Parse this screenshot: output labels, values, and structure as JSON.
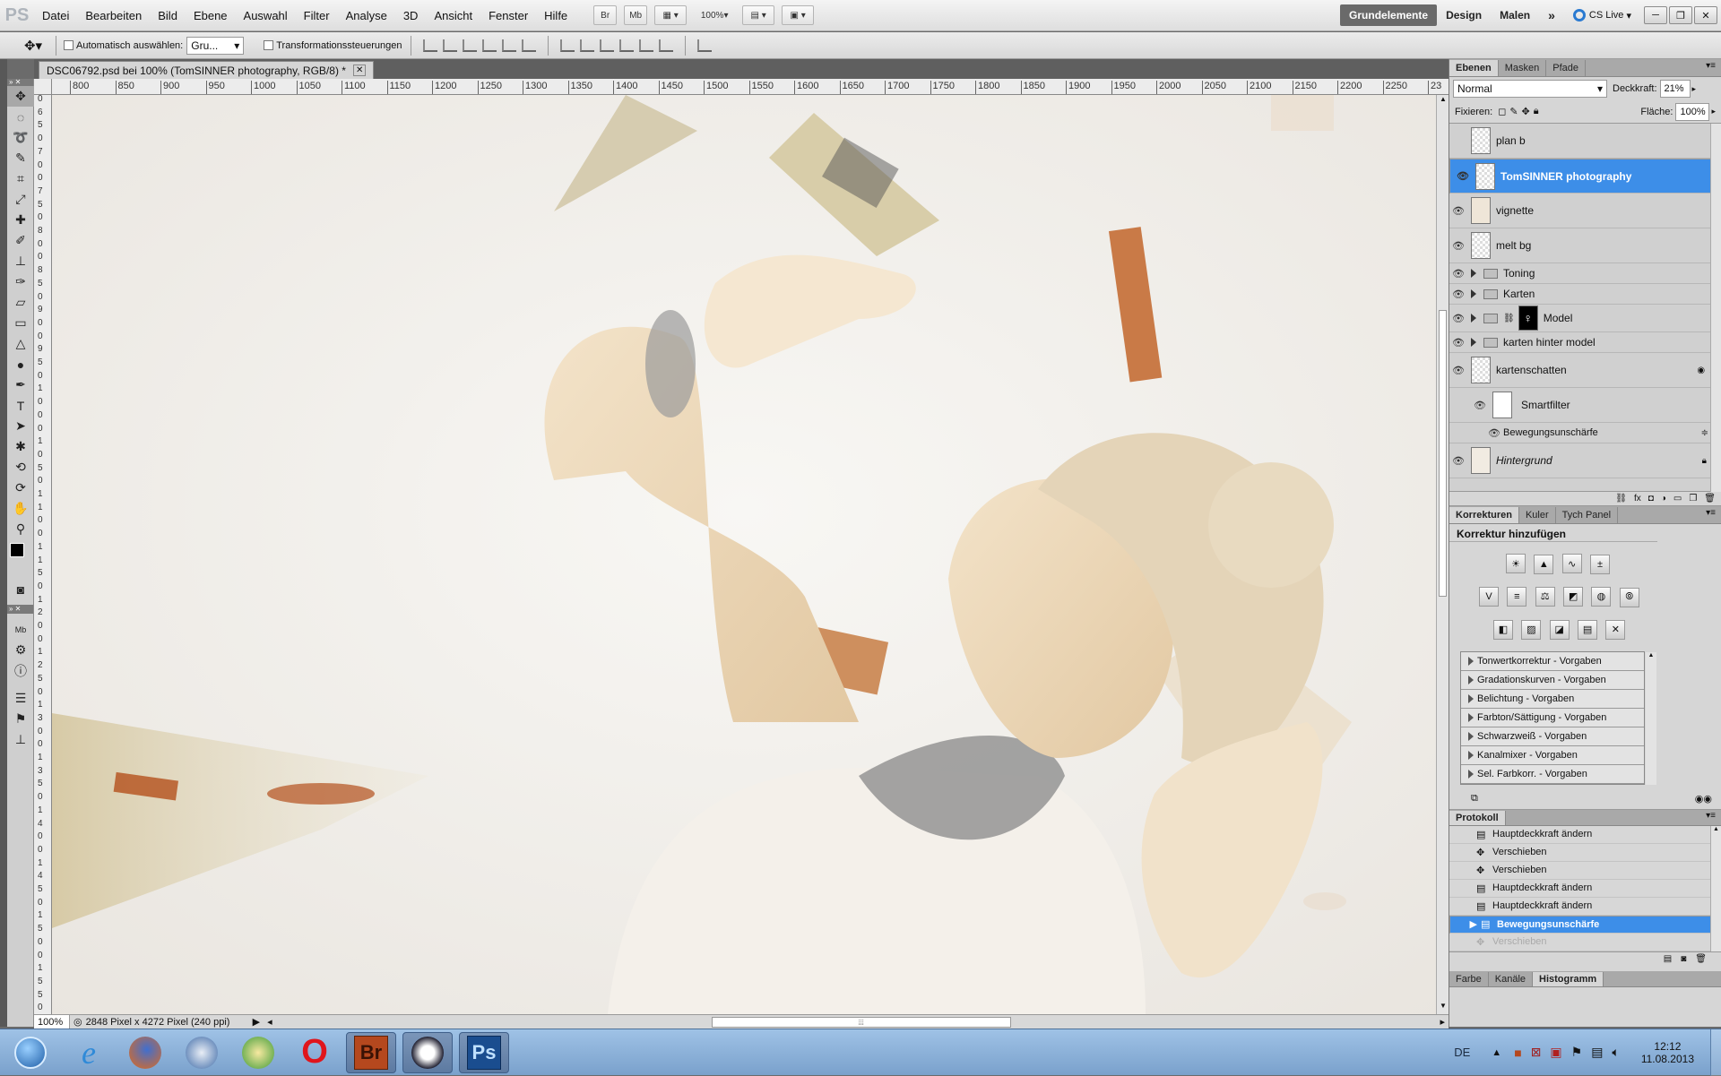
{
  "app": {
    "logo": "PS"
  },
  "menu": [
    "Datei",
    "Bearbeiten",
    "Bild",
    "Ebene",
    "Auswahl",
    "Filter",
    "Analyse",
    "3D",
    "Ansicht",
    "Fenster",
    "Hilfe"
  ],
  "menu_buttons": {
    "br": "Br",
    "mb": "Mb",
    "zoom": "100%"
  },
  "workspaces": [
    "Grundelemente",
    "Design",
    "Malen"
  ],
  "cslive": "CS Live",
  "options": {
    "auto_select_label": "Automatisch auswählen:",
    "auto_select_value": "Gru...",
    "transform_label": "Transformationssteuerungen"
  },
  "document": {
    "tab_title": "DSC06792.psd bei 100% (TomSINNER photography, RGB/8) *",
    "zoom": "100%",
    "size_info": "2848 Pixel x 4272 Pixel (240 ppi)"
  },
  "ruler_top": [
    "800",
    "850",
    "900",
    "950",
    "1000",
    "1050",
    "1100",
    "1150",
    "1200",
    "1250",
    "1300",
    "1350",
    "1400",
    "1450",
    "1500",
    "1550",
    "1600",
    "1650",
    "1700",
    "1750",
    "1800",
    "1850",
    "1900",
    "1950",
    "2000",
    "2050",
    "2100",
    "2150",
    "2200",
    "2250",
    "23"
  ],
  "ruler_left": [
    "0",
    "6",
    "5",
    "0",
    "7",
    "0",
    "0",
    "7",
    "5",
    "0",
    "8",
    "0",
    "0",
    "8",
    "5",
    "0",
    "9",
    "0",
    "0",
    "9",
    "5",
    "0",
    "1",
    "0",
    "0",
    "0",
    "1",
    "0",
    "5",
    "0",
    "1",
    "1",
    "0",
    "0",
    "1",
    "1",
    "5",
    "0",
    "1",
    "2",
    "0",
    "0",
    "1",
    "2",
    "5",
    "0",
    "1",
    "3",
    "0",
    "0",
    "1",
    "3",
    "5",
    "0",
    "1",
    "4",
    "0",
    "0",
    "1",
    "4",
    "5",
    "0",
    "1",
    "5",
    "0",
    "0",
    "1",
    "5",
    "5",
    "0"
  ],
  "layers_panel": {
    "tabs": [
      "Ebenen",
      "Masken",
      "Pfade"
    ],
    "blend_mode": "Normal",
    "opacity_label": "Deckkraft:",
    "opacity": "21%",
    "lock_label": "Fixieren:",
    "fill_label": "Fläche:",
    "fill": "100%",
    "layers": [
      {
        "name": "plan b",
        "kind": "layer",
        "visible": false,
        "selected": false
      },
      {
        "name": "TomSINNER photography",
        "kind": "layer",
        "visible": true,
        "selected": true
      },
      {
        "name": "vignette",
        "kind": "layer",
        "visible": true,
        "selected": false
      },
      {
        "name": "melt bg",
        "kind": "layer",
        "visible": true,
        "selected": false
      },
      {
        "name": "Toning",
        "kind": "group",
        "visible": true,
        "selected": false
      },
      {
        "name": "Karten",
        "kind": "group",
        "visible": true,
        "selected": false
      },
      {
        "name": "Model",
        "kind": "group-mask",
        "visible": true,
        "selected": false
      },
      {
        "name": "karten hinter model",
        "kind": "group",
        "visible": true,
        "selected": false
      },
      {
        "name": "kartenschatten",
        "kind": "smart",
        "visible": true,
        "selected": false
      },
      {
        "name": "Smartfilter",
        "kind": "filter-mask",
        "visible": true,
        "selected": false
      },
      {
        "name": "Bewegungsunschärfe",
        "kind": "filter",
        "visible": true,
        "selected": false
      },
      {
        "name": "Hintergrund",
        "kind": "background",
        "visible": true,
        "selected": false
      }
    ]
  },
  "adjustments_panel": {
    "tabs": [
      "Korrekturen",
      "Kuler",
      "Tych Panel"
    ],
    "title": "Korrektur hinzufügen",
    "presets": [
      "Tonwertkorrektur - Vorgaben",
      "Gradationskurven - Vorgaben",
      "Belichtung - Vorgaben",
      "Farbton/Sättigung - Vorgaben",
      "Schwarzweiß - Vorgaben",
      "Kanalmixer - Vorgaben",
      "Sel. Farbkorr. - Vorgaben"
    ]
  },
  "history_panel": {
    "tab": "Protokoll",
    "items": [
      {
        "label": "Hauptdeckkraft ändern",
        "state": "normal"
      },
      {
        "label": "Verschieben",
        "state": "normal"
      },
      {
        "label": "Verschieben",
        "state": "normal"
      },
      {
        "label": "Hauptdeckkraft ändern",
        "state": "normal"
      },
      {
        "label": "Hauptdeckkraft ändern",
        "state": "normal"
      },
      {
        "label": "Bewegungsunschärfe",
        "state": "selected"
      },
      {
        "label": "Verschieben",
        "state": "ghost"
      }
    ]
  },
  "bottom_tabs": [
    "Farbe",
    "Kanäle",
    "Histogramm"
  ],
  "taskbar": {
    "apps": [
      {
        "id": "start",
        "label": ""
      },
      {
        "id": "ie",
        "label": "e"
      },
      {
        "id": "firefox",
        "label": ""
      },
      {
        "id": "thunderbird",
        "label": ""
      },
      {
        "id": "chrome-like",
        "label": ""
      },
      {
        "id": "opera",
        "label": "O"
      },
      {
        "id": "bridge",
        "label": "Br"
      },
      {
        "id": "napster",
        "label": ""
      },
      {
        "id": "photoshop",
        "label": "Ps"
      }
    ],
    "lang": "DE",
    "time": "12:12",
    "date": "11.08.2013"
  },
  "colors": {
    "selection": "#3d8ee8",
    "bridge": "#b5481e",
    "photoshop": "#1a4d8f"
  }
}
